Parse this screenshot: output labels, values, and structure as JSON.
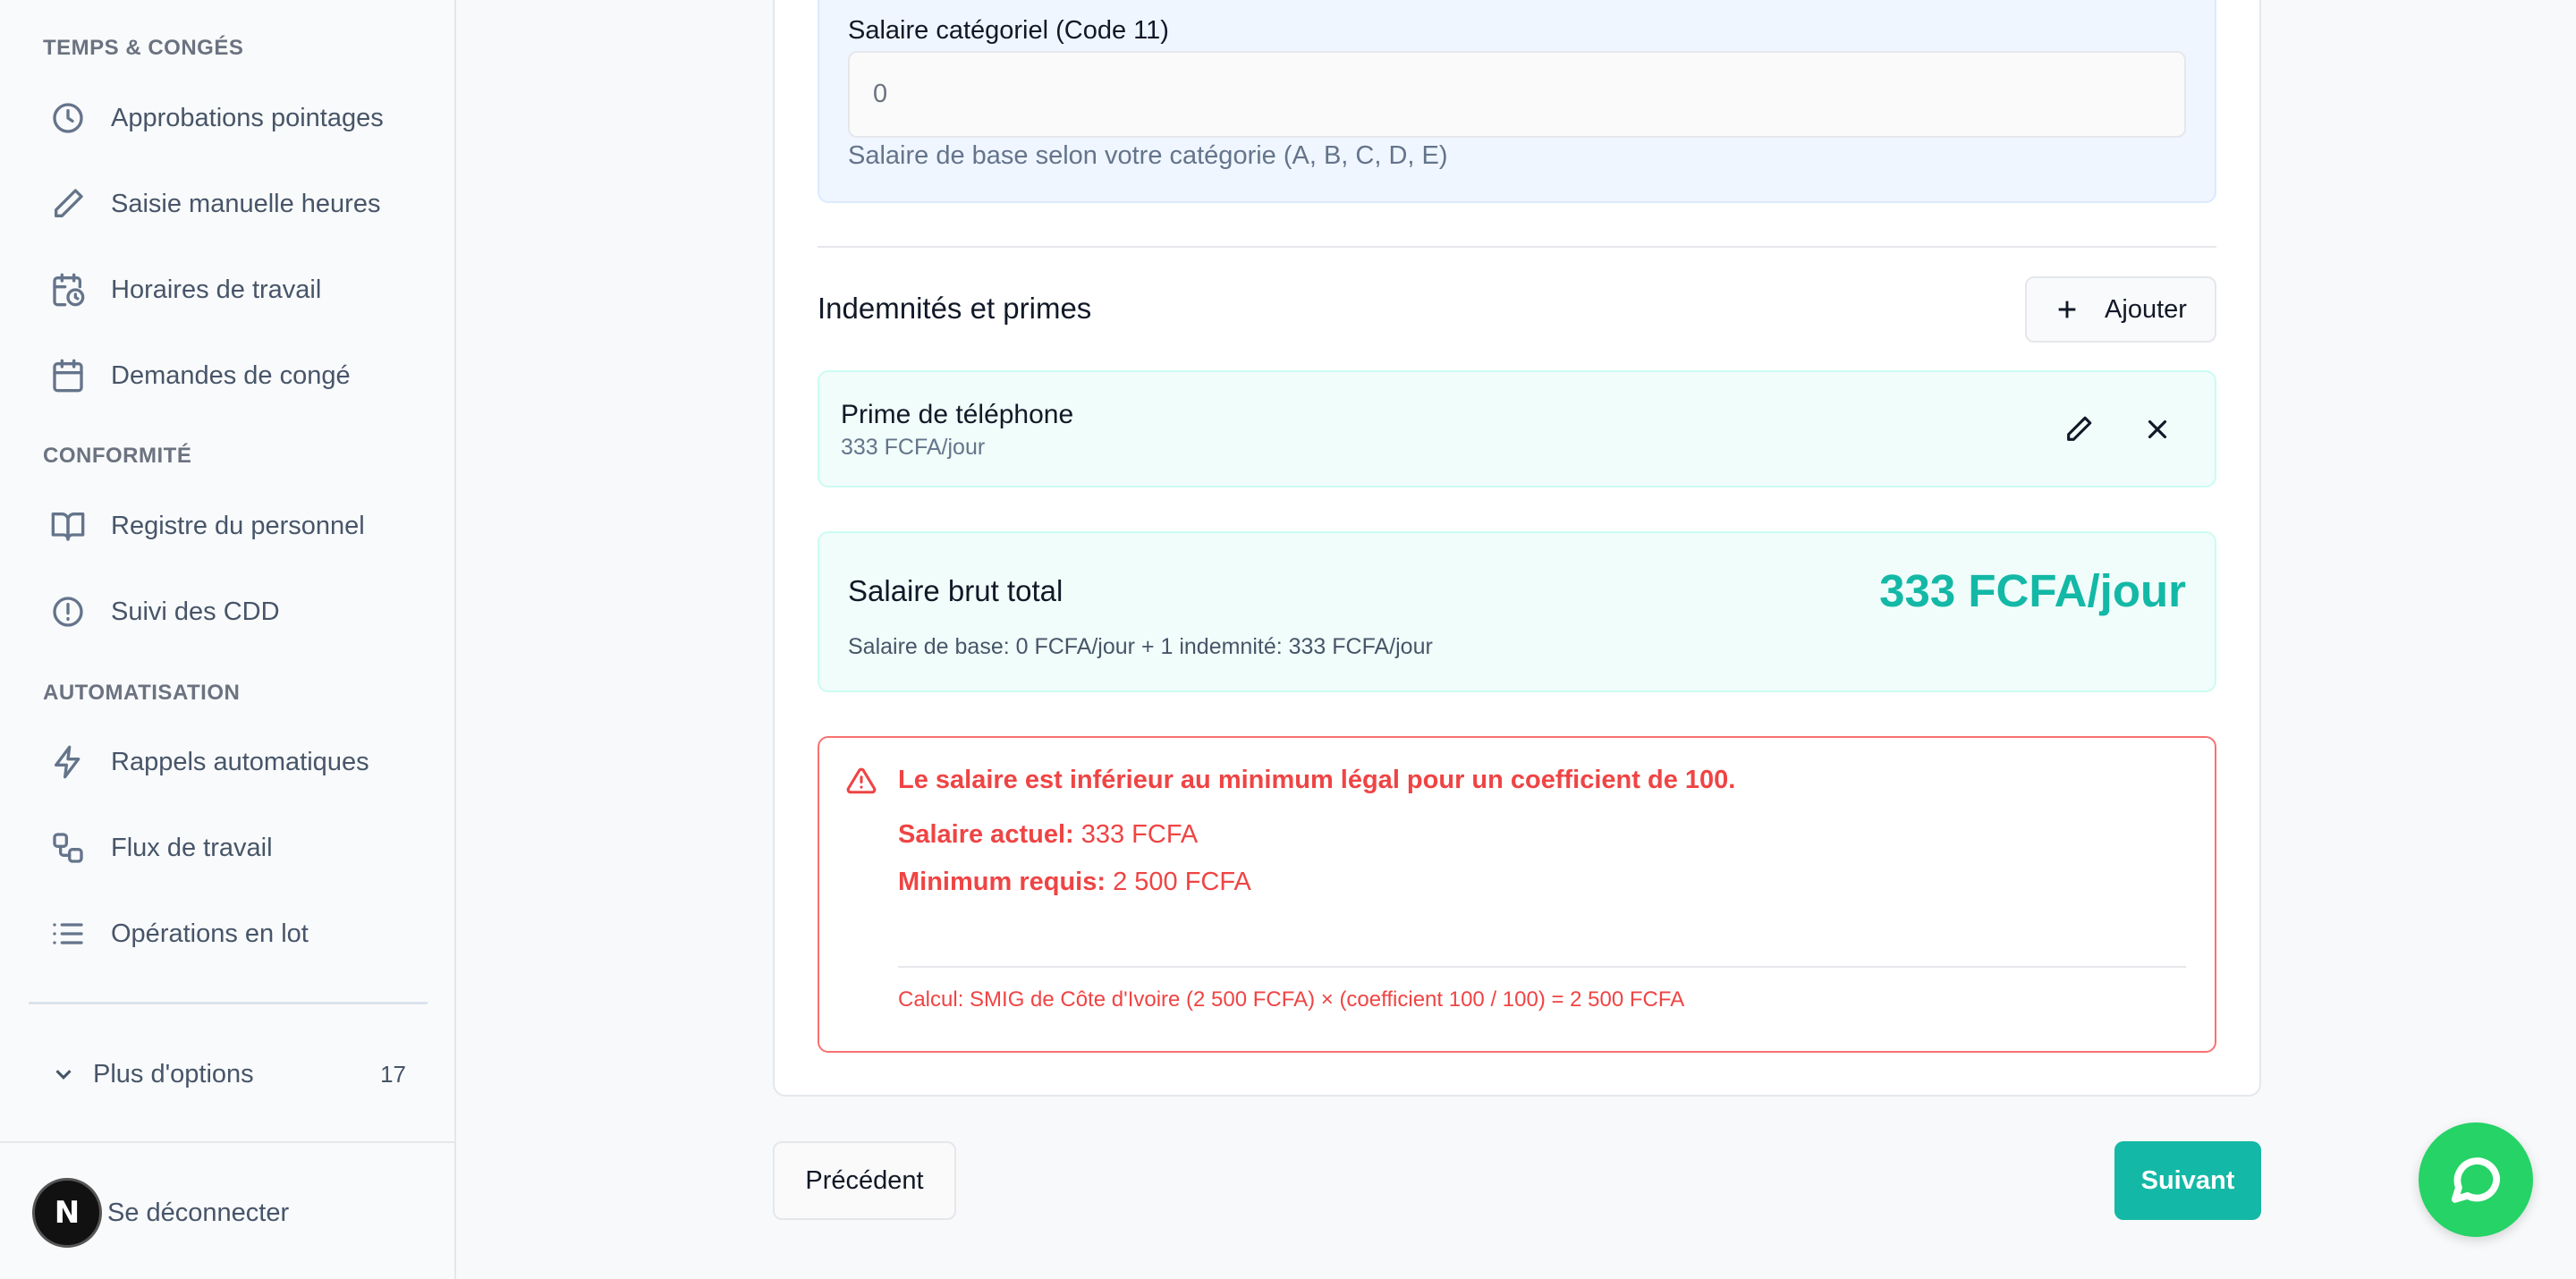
{
  "sidebar": {
    "sections": {
      "time": "TEMPS & CONGÉS",
      "compliance": "CONFORMITÉ",
      "automation": "AUTOMATISATION"
    },
    "items": [
      {
        "label": "Approbations pointages",
        "icon": "clock-icon"
      },
      {
        "label": "Saisie manuelle heures",
        "icon": "pencil-icon"
      },
      {
        "label": "Horaires de travail",
        "icon": "calendar-clock-icon"
      },
      {
        "label": "Demandes de congé",
        "icon": "calendar-icon"
      },
      {
        "label": "Registre du personnel",
        "icon": "book-open-icon"
      },
      {
        "label": "Suivi des CDD",
        "icon": "alert-circle-icon"
      },
      {
        "label": "Rappels automatiques",
        "icon": "zap-icon"
      },
      {
        "label": "Flux de travail",
        "icon": "workflow-icon"
      },
      {
        "label": "Opérations en lot",
        "icon": "list-icon"
      }
    ],
    "more_options": {
      "label": "Plus d'options",
      "count": "17"
    },
    "logout": {
      "avatar_letter": "N",
      "label": "Se déconnecter"
    }
  },
  "form": {
    "base_salary": {
      "label": "Salaire catégoriel (Code 11)",
      "value": "0",
      "help": "Salaire de base selon votre catégorie (A, B, C, D, E)"
    },
    "allowances": {
      "heading": "Indemnités et primes",
      "add_label": "Ajouter",
      "items": [
        {
          "name": "Prime de téléphone",
          "amount": "333 FCFA/jour"
        }
      ]
    },
    "total": {
      "label": "Salaire brut total",
      "value": "333 FCFA/jour",
      "detail": "Salaire de base: 0 FCFA/jour + 1 indemnité: 333 FCFA/jour"
    },
    "alert": {
      "title": "Le salaire est inférieur au minimum légal pour un coefficient de 100.",
      "current_label": "Salaire actuel:",
      "current_value": "333 FCFA",
      "minimum_label": "Minimum requis:",
      "minimum_value": "2 500 FCFA",
      "calculation": "Calcul: SMIG de Côte d'Ivoire (2 500 FCFA) × (coefficient 100 / 100) = 2 500 FCFA"
    }
  },
  "navigation": {
    "previous": "Précédent",
    "next": "Suivant"
  },
  "colors": {
    "accent": "#14b8a6",
    "error": "#ef4444",
    "chat": "#25d366"
  }
}
